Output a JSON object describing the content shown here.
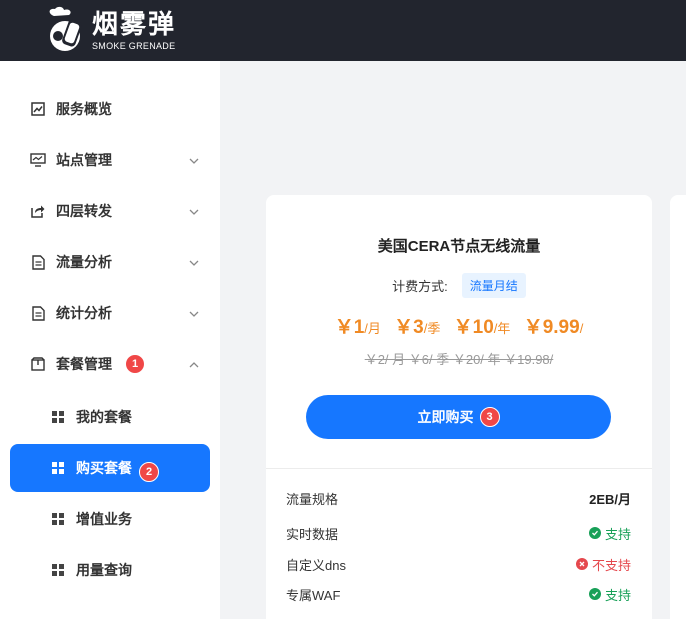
{
  "brand": {
    "name_cn": "烟雾弹",
    "name_en": "SMOKE GRENADE"
  },
  "sidebar": {
    "items": [
      {
        "label": "服务概览",
        "icon": "chart-icon",
        "has_chevron": false
      },
      {
        "label": "站点管理",
        "icon": "monitor-icon",
        "has_chevron": true
      },
      {
        "label": "四层转发",
        "icon": "share-icon",
        "has_chevron": true
      },
      {
        "label": "流量分析",
        "icon": "document-icon",
        "has_chevron": true
      },
      {
        "label": "统计分析",
        "icon": "document-icon",
        "has_chevron": true
      },
      {
        "label": "套餐管理",
        "icon": "package-icon",
        "has_chevron": true,
        "expanded": true,
        "badge": "1"
      }
    ],
    "sub_items": [
      {
        "label": "我的套餐",
        "active": false
      },
      {
        "label": "购买套餐",
        "active": true,
        "badge": "2"
      },
      {
        "label": "增值业务",
        "active": false
      },
      {
        "label": "用量查询",
        "active": false
      }
    ]
  },
  "card": {
    "title": "美国CERA节点无线流量",
    "billing_label": "计费方式:",
    "billing_tag": "流量月结",
    "prices": [
      {
        "amount": "￥1",
        "unit": "/月"
      },
      {
        "amount": "￥3",
        "unit": "/季"
      },
      {
        "amount": "￥10",
        "unit": "/年"
      },
      {
        "amount": "￥9.99",
        "unit": "/"
      }
    ],
    "old_prices": "￥2/ 月 ￥6/ 季 ￥20/ 年 ￥19.98/",
    "buy_label": "立即购买",
    "buy_badge": "3",
    "specs": [
      {
        "label": "流量规格",
        "value": "2EB/月",
        "type": "text"
      },
      {
        "label": "实时数据",
        "value": "支持",
        "type": "ok"
      },
      {
        "label": "自定义dns",
        "value": "不支持",
        "type": "no"
      },
      {
        "label": "专属WAF",
        "value": "支持",
        "type": "ok"
      }
    ]
  },
  "colors": {
    "header_bg": "#22252e",
    "accent": "#1677ff",
    "price": "#f08a24",
    "badge": "#f04747",
    "ok": "#18a058",
    "no": "#e5484d"
  }
}
